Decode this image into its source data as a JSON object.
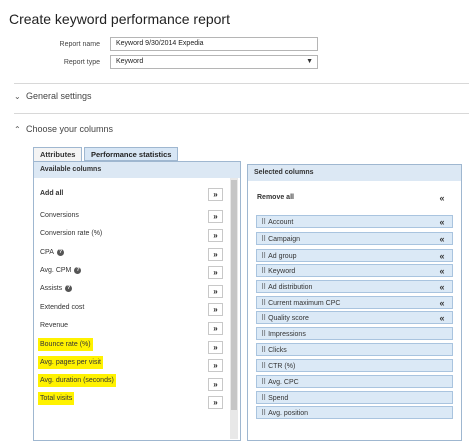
{
  "page": {
    "title": "Create keyword performance report"
  },
  "form": {
    "report_name_label": "Report name",
    "report_name_value": "Keyword 9/30/2014 Expedia",
    "report_type_label": "Report type",
    "report_type_value": "Keyword"
  },
  "sections": {
    "general_settings": "General settings",
    "choose_columns": "Choose your columns"
  },
  "tabs": [
    {
      "label": "Attributes"
    },
    {
      "label": "Performance statistics"
    }
  ],
  "available": {
    "header": "Available columns",
    "add_all": "Add all",
    "add_icon": "»",
    "items": [
      {
        "label": "Conversions"
      },
      {
        "label": "Conversion rate (%)"
      },
      {
        "label": "CPA"
      },
      {
        "label": "Avg. CPM"
      },
      {
        "label": "Assists"
      },
      {
        "label": "Extended cost"
      },
      {
        "label": "Revenue"
      },
      {
        "label": "Bounce rate (%)"
      },
      {
        "label": "Avg. pages per visit"
      },
      {
        "label": "Avg. duration (seconds)"
      },
      {
        "label": "Total visits"
      }
    ]
  },
  "selected": {
    "header": "Selected columns",
    "remove_all": "Remove all",
    "remove_icon": "«",
    "items": [
      {
        "label": "Account"
      },
      {
        "label": "Campaign"
      },
      {
        "label": "Ad group"
      },
      {
        "label": "Keyword"
      },
      {
        "label": "Ad distribution"
      },
      {
        "label": "Current maximum CPC"
      },
      {
        "label": "Quality score"
      },
      {
        "label": "Impressions"
      },
      {
        "label": "Clicks"
      },
      {
        "label": "CTR (%)"
      },
      {
        "label": "Avg. CPC"
      },
      {
        "label": "Spend"
      },
      {
        "label": "Avg. position"
      }
    ]
  },
  "colors": {
    "highlight": "#fff200",
    "panel_header": "#dce8f4",
    "selected_item": "#dbe9f6"
  }
}
